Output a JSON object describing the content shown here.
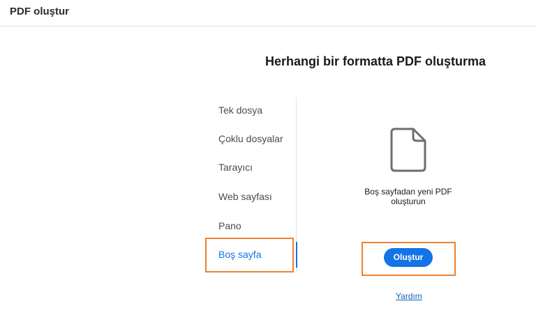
{
  "header": {
    "title": "PDF oluştur"
  },
  "main": {
    "heading": "Herhangi bir formatta PDF oluşturma"
  },
  "nav": {
    "items": [
      {
        "label": "Tek dosya"
      },
      {
        "label": "Çoklu dosyalar"
      },
      {
        "label": "Tarayıcı"
      },
      {
        "label": "Web sayfası"
      },
      {
        "label": "Pano"
      },
      {
        "label": "Boş sayfa"
      }
    ],
    "selected_index": 5
  },
  "panel": {
    "icon": "blank-document-icon",
    "description": "Boş sayfadan yeni PDF oluşturun",
    "create_label": "Oluştur",
    "help_label": "Yardım"
  },
  "colors": {
    "accent": "#1473e6",
    "highlight": "#f0812c",
    "link": "#1464b4"
  }
}
